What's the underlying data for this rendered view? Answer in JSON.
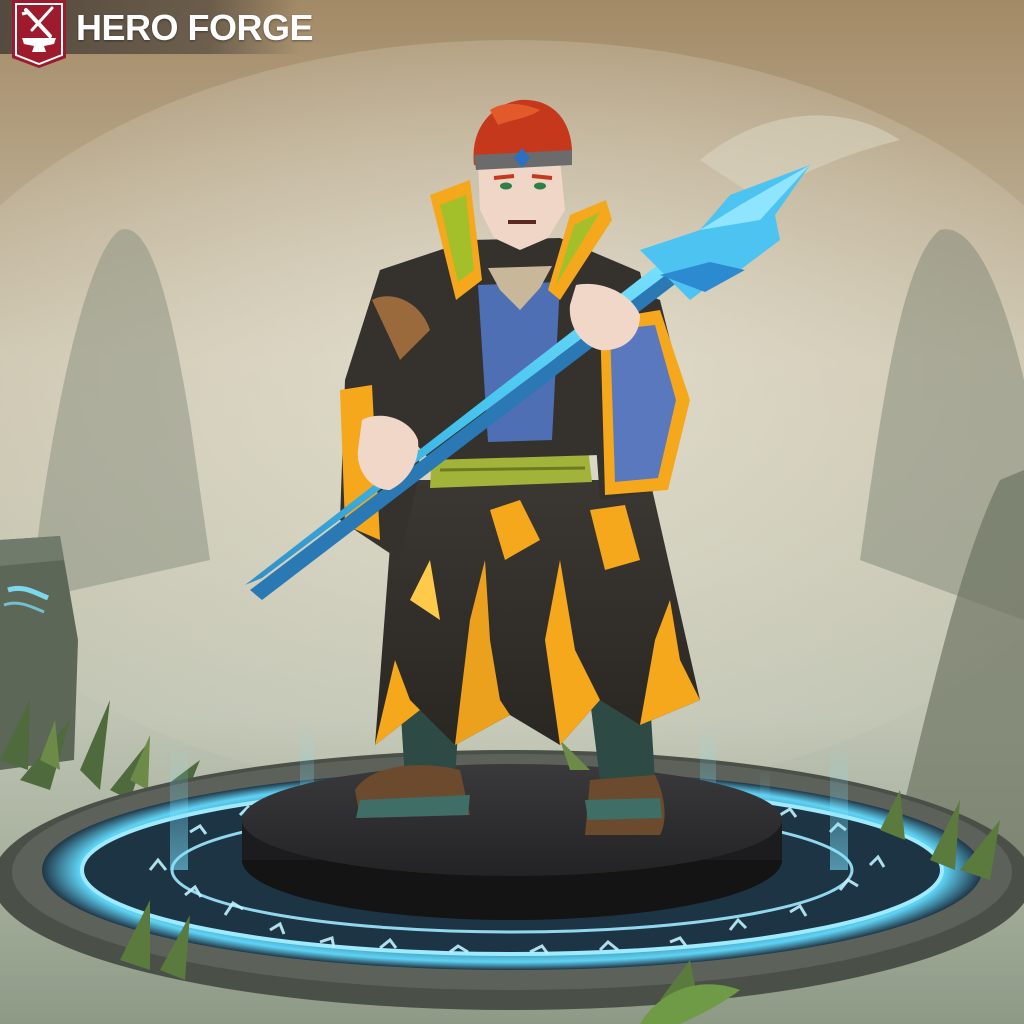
{
  "brand": {
    "name": "HERO FORGE",
    "accent_color": "#9e1b2e",
    "logo_icon": "anvil-sword-icon"
  },
  "scene": {
    "background_icon": "misty-mountains-backdrop",
    "character": "wizard-miniature",
    "base": "glowing-rune-circle-platform",
    "rune_glow_color": "#7fe4ff",
    "robe_trim_color": "#f5a81c",
    "staff_color": "#3fb6e8"
  }
}
